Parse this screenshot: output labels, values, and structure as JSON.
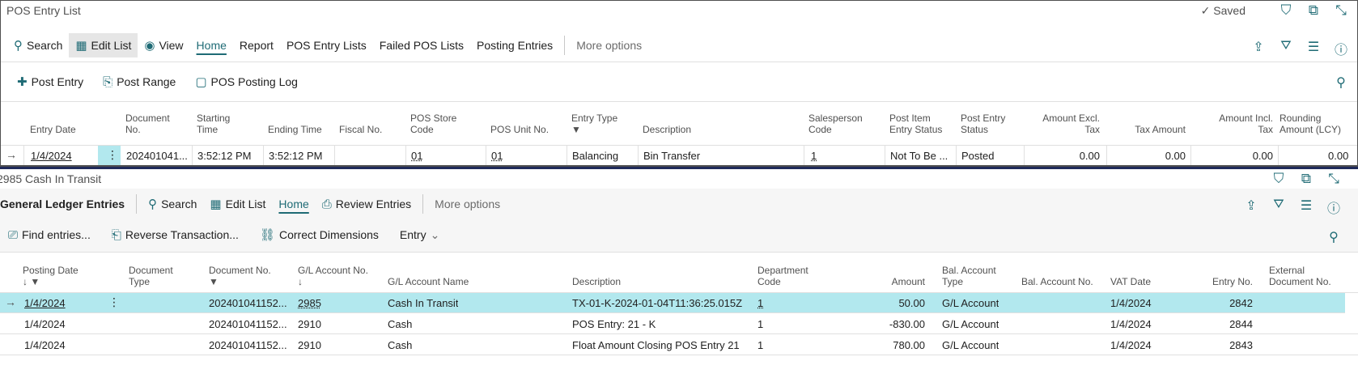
{
  "pane1": {
    "title": "POS Entry List",
    "saved_label": "Saved",
    "actions": {
      "search": "Search",
      "edit_list": "Edit List",
      "view": "View",
      "home": "Home",
      "report": "Report",
      "pos_entry_lists": "POS Entry Lists",
      "failed_pos_lists": "Failed POS Lists",
      "posting_entries": "Posting Entries",
      "more_options": "More options"
    },
    "sub_actions": {
      "post_entry": "Post Entry",
      "post_range": "Post Range",
      "pos_posting_log": "POS Posting Log"
    },
    "columns": [
      "Entry Date",
      "Document\nNo.",
      "Starting\nTime",
      "Ending Time",
      "Fiscal No.",
      "POS Store\nCode",
      "POS Unit No.",
      "Entry Type",
      "Description",
      "Salesperson\nCode",
      "Post Item\nEntry Status",
      "Post Entry\nStatus",
      "Amount Excl.\nTax",
      "Tax Amount",
      "Amount Incl.\nTax",
      "Rounding\nAmount (LCY)"
    ],
    "row": {
      "entry_date": "1/4/2024",
      "document_no": "202401041...",
      "starting_time": "3:52:12 PM",
      "ending_time": "3:52:12 PM",
      "fiscal_no": "",
      "pos_store_code": "01",
      "pos_unit_no": "01",
      "entry_type": "Balancing",
      "description": "Bin Transfer",
      "salesperson_code": "1",
      "post_item_entry_status": "Not To Be ...",
      "post_entry_status": "Posted",
      "amount_excl_tax": "0.00",
      "tax_amount": "0.00",
      "amount_incl_tax": "0.00",
      "rounding_amount": "0.00"
    }
  },
  "pane2": {
    "title": "2985 Cash In Transit",
    "actions": {
      "gl_entries": "General Ledger Entries",
      "search": "Search",
      "edit_list": "Edit List",
      "home": "Home",
      "review_entries": "Review Entries",
      "more_options": "More options"
    },
    "sub_actions": {
      "find_entries": "Find entries...",
      "reverse_transaction": "Reverse Transaction...",
      "correct_dimensions": "Correct Dimensions",
      "entry": "Entry"
    },
    "columns": [
      "Posting Date",
      "Document\nType",
      "Document No.",
      "G/L Account No.",
      "G/L Account Name",
      "Description",
      "Department\nCode",
      "Amount",
      "Bal. Account\nType",
      "Bal. Account No.",
      "VAT Date",
      "Entry No.",
      "External\nDocument No."
    ],
    "rows": [
      {
        "posting_date": "1/4/2024",
        "document_type": "",
        "document_no": "202401041152...",
        "gl_account_no": "2985",
        "gl_account_name": "Cash In Transit",
        "description": "TX-01-K-2024-01-04T11:36:25.015Z",
        "department_code": "1",
        "amount": "50.00",
        "bal_account_type": "G/L Account",
        "bal_account_no": "",
        "vat_date": "1/4/2024",
        "entry_no": "2842",
        "external_document_no": ""
      },
      {
        "posting_date": "1/4/2024",
        "document_type": "",
        "document_no": "202401041152...",
        "gl_account_no": "2910",
        "gl_account_name": "Cash",
        "description": "POS Entry: 21 - K",
        "department_code": "1",
        "amount": "-830.00",
        "bal_account_type": "G/L Account",
        "bal_account_no": "",
        "vat_date": "1/4/2024",
        "entry_no": "2844",
        "external_document_no": ""
      },
      {
        "posting_date": "1/4/2024",
        "document_type": "",
        "document_no": "202401041152...",
        "gl_account_no": "2910",
        "gl_account_name": "Cash",
        "description": "Float Amount Closing POS Entry 21",
        "department_code": "1",
        "amount": "780.00",
        "bal_account_type": "G/L Account",
        "bal_account_no": "",
        "vat_date": "1/4/2024",
        "entry_no": "2843",
        "external_document_no": ""
      }
    ]
  },
  "icons": [
    "search-icon",
    "edit-list-icon",
    "view-icon",
    "bookmark-icon",
    "open-new-window-icon",
    "collapse-icon",
    "share-icon",
    "filter-icon",
    "list-icon",
    "info-icon",
    "pin-icon",
    "checkmark-icon",
    "row-arrow-icon",
    "more-dots-icon"
  ],
  "colors": {
    "accent": "#1f6b75",
    "selected_row": "#b2e8ee",
    "divider": "#1f2a5a"
  }
}
